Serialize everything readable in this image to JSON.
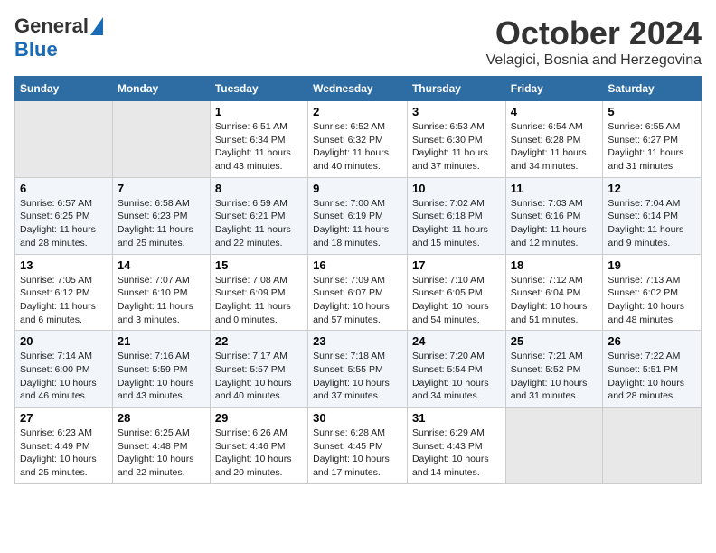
{
  "logo": {
    "general": "General",
    "blue": "Blue"
  },
  "title": "October 2024",
  "subtitle": "Velagici, Bosnia and Herzegovina",
  "headers": [
    "Sunday",
    "Monday",
    "Tuesday",
    "Wednesday",
    "Thursday",
    "Friday",
    "Saturday"
  ],
  "weeks": [
    [
      {
        "num": "",
        "info": ""
      },
      {
        "num": "",
        "info": ""
      },
      {
        "num": "1",
        "info": "Sunrise: 6:51 AM\nSunset: 6:34 PM\nDaylight: 11 hours and 43 minutes."
      },
      {
        "num": "2",
        "info": "Sunrise: 6:52 AM\nSunset: 6:32 PM\nDaylight: 11 hours and 40 minutes."
      },
      {
        "num": "3",
        "info": "Sunrise: 6:53 AM\nSunset: 6:30 PM\nDaylight: 11 hours and 37 minutes."
      },
      {
        "num": "4",
        "info": "Sunrise: 6:54 AM\nSunset: 6:28 PM\nDaylight: 11 hours and 34 minutes."
      },
      {
        "num": "5",
        "info": "Sunrise: 6:55 AM\nSunset: 6:27 PM\nDaylight: 11 hours and 31 minutes."
      }
    ],
    [
      {
        "num": "6",
        "info": "Sunrise: 6:57 AM\nSunset: 6:25 PM\nDaylight: 11 hours and 28 minutes."
      },
      {
        "num": "7",
        "info": "Sunrise: 6:58 AM\nSunset: 6:23 PM\nDaylight: 11 hours and 25 minutes."
      },
      {
        "num": "8",
        "info": "Sunrise: 6:59 AM\nSunset: 6:21 PM\nDaylight: 11 hours and 22 minutes."
      },
      {
        "num": "9",
        "info": "Sunrise: 7:00 AM\nSunset: 6:19 PM\nDaylight: 11 hours and 18 minutes."
      },
      {
        "num": "10",
        "info": "Sunrise: 7:02 AM\nSunset: 6:18 PM\nDaylight: 11 hours and 15 minutes."
      },
      {
        "num": "11",
        "info": "Sunrise: 7:03 AM\nSunset: 6:16 PM\nDaylight: 11 hours and 12 minutes."
      },
      {
        "num": "12",
        "info": "Sunrise: 7:04 AM\nSunset: 6:14 PM\nDaylight: 11 hours and 9 minutes."
      }
    ],
    [
      {
        "num": "13",
        "info": "Sunrise: 7:05 AM\nSunset: 6:12 PM\nDaylight: 11 hours and 6 minutes."
      },
      {
        "num": "14",
        "info": "Sunrise: 7:07 AM\nSunset: 6:10 PM\nDaylight: 11 hours and 3 minutes."
      },
      {
        "num": "15",
        "info": "Sunrise: 7:08 AM\nSunset: 6:09 PM\nDaylight: 11 hours and 0 minutes."
      },
      {
        "num": "16",
        "info": "Sunrise: 7:09 AM\nSunset: 6:07 PM\nDaylight: 10 hours and 57 minutes."
      },
      {
        "num": "17",
        "info": "Sunrise: 7:10 AM\nSunset: 6:05 PM\nDaylight: 10 hours and 54 minutes."
      },
      {
        "num": "18",
        "info": "Sunrise: 7:12 AM\nSunset: 6:04 PM\nDaylight: 10 hours and 51 minutes."
      },
      {
        "num": "19",
        "info": "Sunrise: 7:13 AM\nSunset: 6:02 PM\nDaylight: 10 hours and 48 minutes."
      }
    ],
    [
      {
        "num": "20",
        "info": "Sunrise: 7:14 AM\nSunset: 6:00 PM\nDaylight: 10 hours and 46 minutes."
      },
      {
        "num": "21",
        "info": "Sunrise: 7:16 AM\nSunset: 5:59 PM\nDaylight: 10 hours and 43 minutes."
      },
      {
        "num": "22",
        "info": "Sunrise: 7:17 AM\nSunset: 5:57 PM\nDaylight: 10 hours and 40 minutes."
      },
      {
        "num": "23",
        "info": "Sunrise: 7:18 AM\nSunset: 5:55 PM\nDaylight: 10 hours and 37 minutes."
      },
      {
        "num": "24",
        "info": "Sunrise: 7:20 AM\nSunset: 5:54 PM\nDaylight: 10 hours and 34 minutes."
      },
      {
        "num": "25",
        "info": "Sunrise: 7:21 AM\nSunset: 5:52 PM\nDaylight: 10 hours and 31 minutes."
      },
      {
        "num": "26",
        "info": "Sunrise: 7:22 AM\nSunset: 5:51 PM\nDaylight: 10 hours and 28 minutes."
      }
    ],
    [
      {
        "num": "27",
        "info": "Sunrise: 6:23 AM\nSunset: 4:49 PM\nDaylight: 10 hours and 25 minutes."
      },
      {
        "num": "28",
        "info": "Sunrise: 6:25 AM\nSunset: 4:48 PM\nDaylight: 10 hours and 22 minutes."
      },
      {
        "num": "29",
        "info": "Sunrise: 6:26 AM\nSunset: 4:46 PM\nDaylight: 10 hours and 20 minutes."
      },
      {
        "num": "30",
        "info": "Sunrise: 6:28 AM\nSunset: 4:45 PM\nDaylight: 10 hours and 17 minutes."
      },
      {
        "num": "31",
        "info": "Sunrise: 6:29 AM\nSunset: 4:43 PM\nDaylight: 10 hours and 14 minutes."
      },
      {
        "num": "",
        "info": ""
      },
      {
        "num": "",
        "info": ""
      }
    ]
  ]
}
